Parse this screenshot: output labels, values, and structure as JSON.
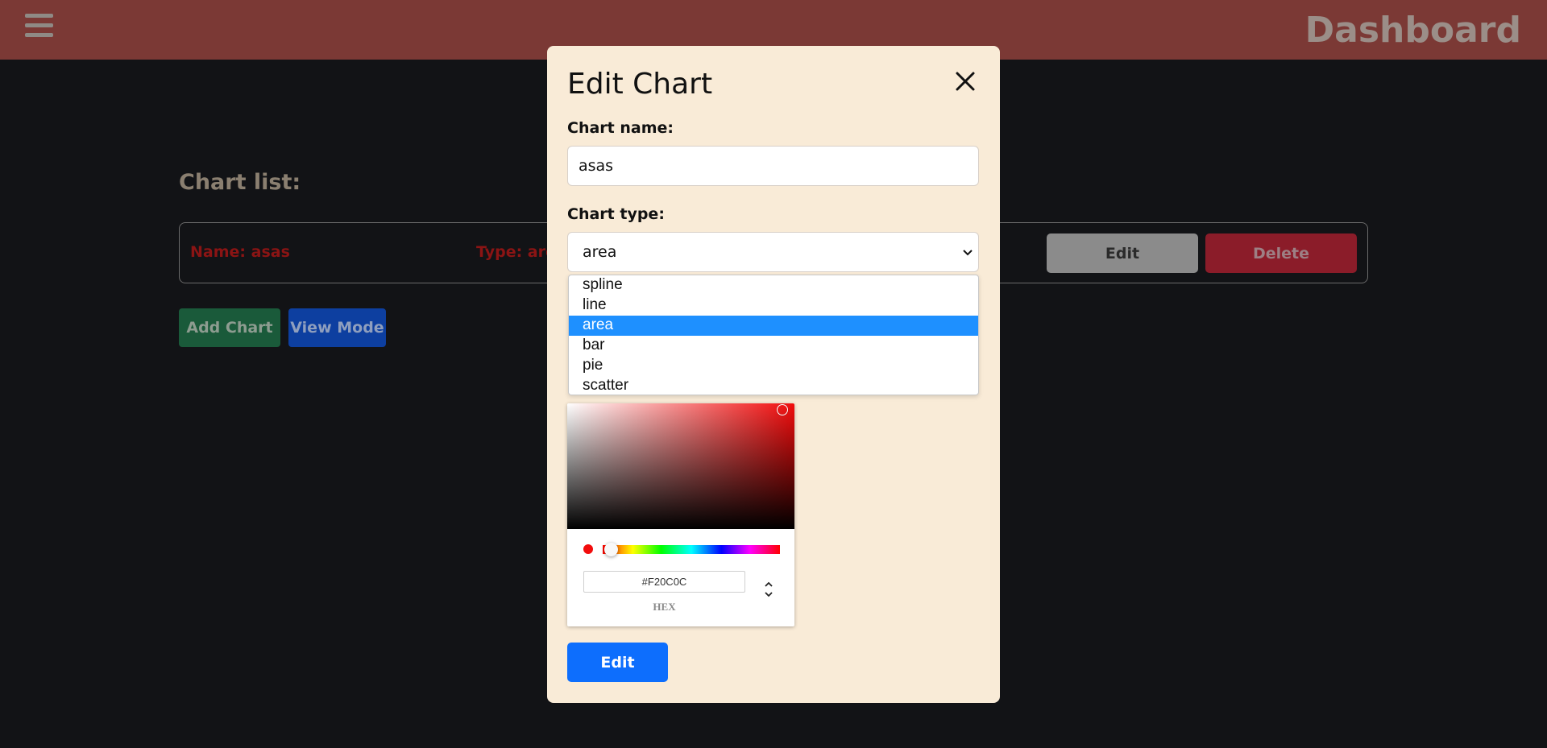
{
  "header": {
    "title": "Dashboard",
    "menu_icon": "hamburger-menu-icon"
  },
  "main": {
    "list_title": "Chart list:",
    "rows": [
      {
        "name_text": "Name: asas",
        "type_text": "Type: area",
        "edit_label": "Edit",
        "delete_label": "Delete"
      }
    ],
    "add_label": "Add Chart",
    "view_label": "View Mode"
  },
  "modal": {
    "title": "Edit Chart",
    "close_icon": "close-icon",
    "name_label": "Chart name:",
    "name_value": "asas",
    "type_label": "Chart type:",
    "type_value": "area",
    "type_options": [
      "spline",
      "line",
      "area",
      "bar",
      "pie",
      "scatter"
    ],
    "selected_option": "area",
    "color_picker": {
      "hex_value": "#F20C0C",
      "mode_label": "HEX",
      "current_color": "#F20C0C"
    },
    "submit_label": "Edit"
  },
  "colors": {
    "header_bg": "#7b3935",
    "modal_bg": "#f9ebd7",
    "primary": "#0d6efd",
    "option_highlight": "#1e90ff"
  }
}
